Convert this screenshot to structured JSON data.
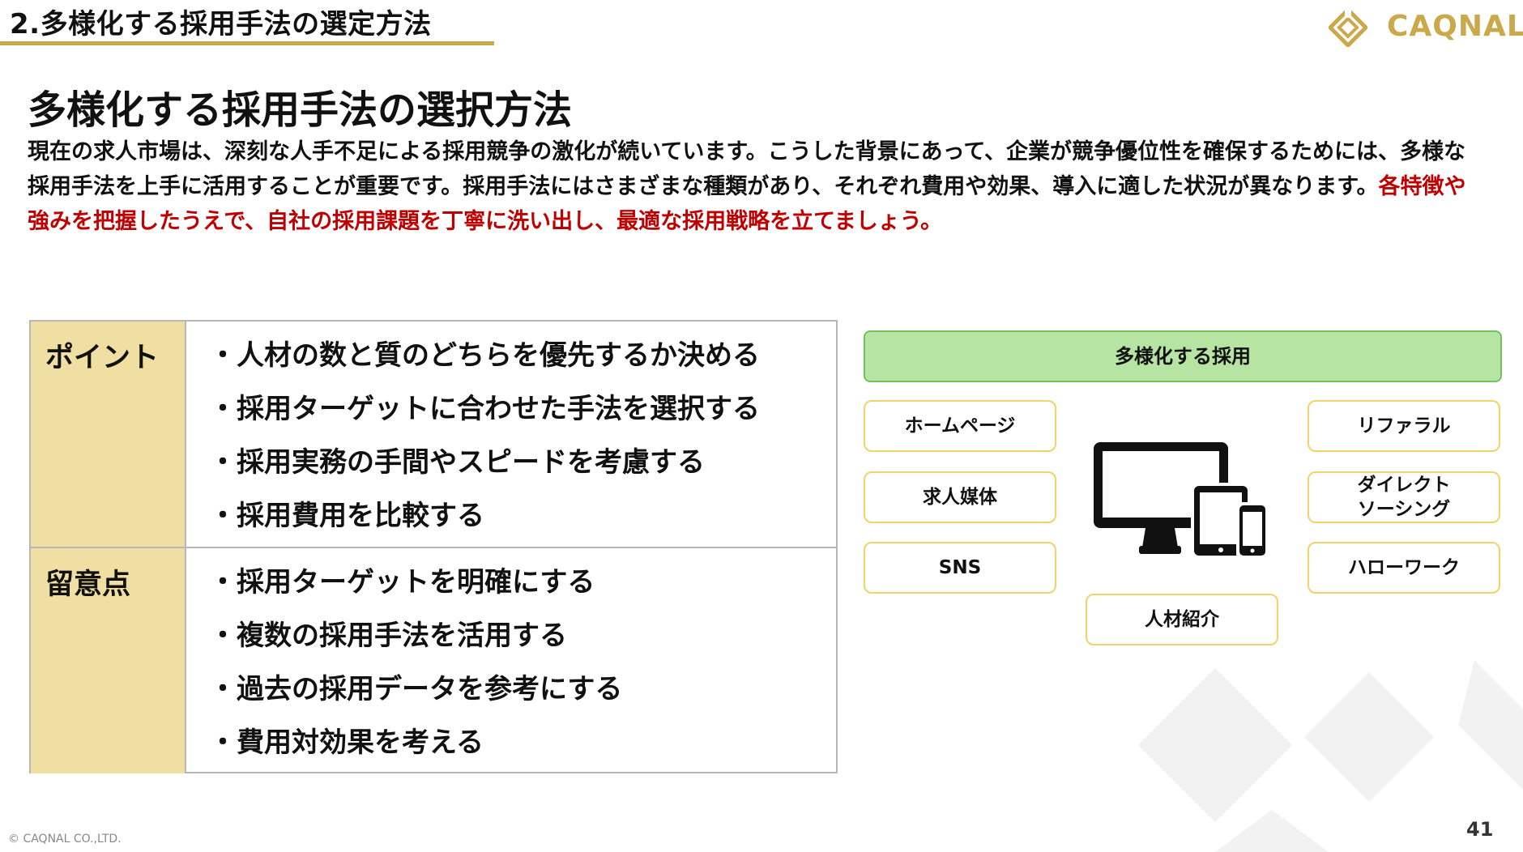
{
  "header": {
    "section_title": "2.多様化する採用手法の選定方法",
    "logo_text": "CAQNAL"
  },
  "page_title": "多様化する採用手法の選択方法",
  "intro": {
    "plain": "現在の求人市場は、深刻な人手不足による採用競争の激化が続いています。こうした背景にあって、企業が競争優位性を確保するためには、多様な採用手法を上手に活用することが重要です。採用手法にはさまざまな種類があり、それぞれ費用や効果、導入に適した状況が異なります。",
    "highlight": "各特徴や強みを把握したうえで、自社の採用課題を丁寧に洗い出し、最適な採用戦略を立てましょう。"
  },
  "table": {
    "rows": [
      {
        "label": "ポイント",
        "items": [
          "人材の数と質のどちらを優先するか決める",
          "採用ターゲットに合わせた手法を選択する",
          "採用実務の手間やスピードを考慮する",
          "採用費用を比較する"
        ]
      },
      {
        "label": "留意点",
        "items": [
          "採用ターゲットを明確にする",
          "複数の採用手法を活用する",
          "過去の採用データを参考にする",
          "費用対効果を考える"
        ]
      }
    ]
  },
  "diagram": {
    "header": "多様化する採用",
    "left": [
      "ホームページ",
      "求人媒体",
      "SNS"
    ],
    "right": [
      "リファラル",
      "ダイレクト\nソーシング",
      "ハローワーク"
    ],
    "bottom": "人材紹介"
  },
  "colors": {
    "accent_gold": "#c9a94a",
    "highlight_red": "#c00000",
    "label_bg": "#efdfa2",
    "green_fill": "#b5e4a3",
    "chip_border": "#f1d36a"
  },
  "footer": {
    "copyright": "© CAQNAL CO.,LTD.",
    "page_number": "41"
  }
}
